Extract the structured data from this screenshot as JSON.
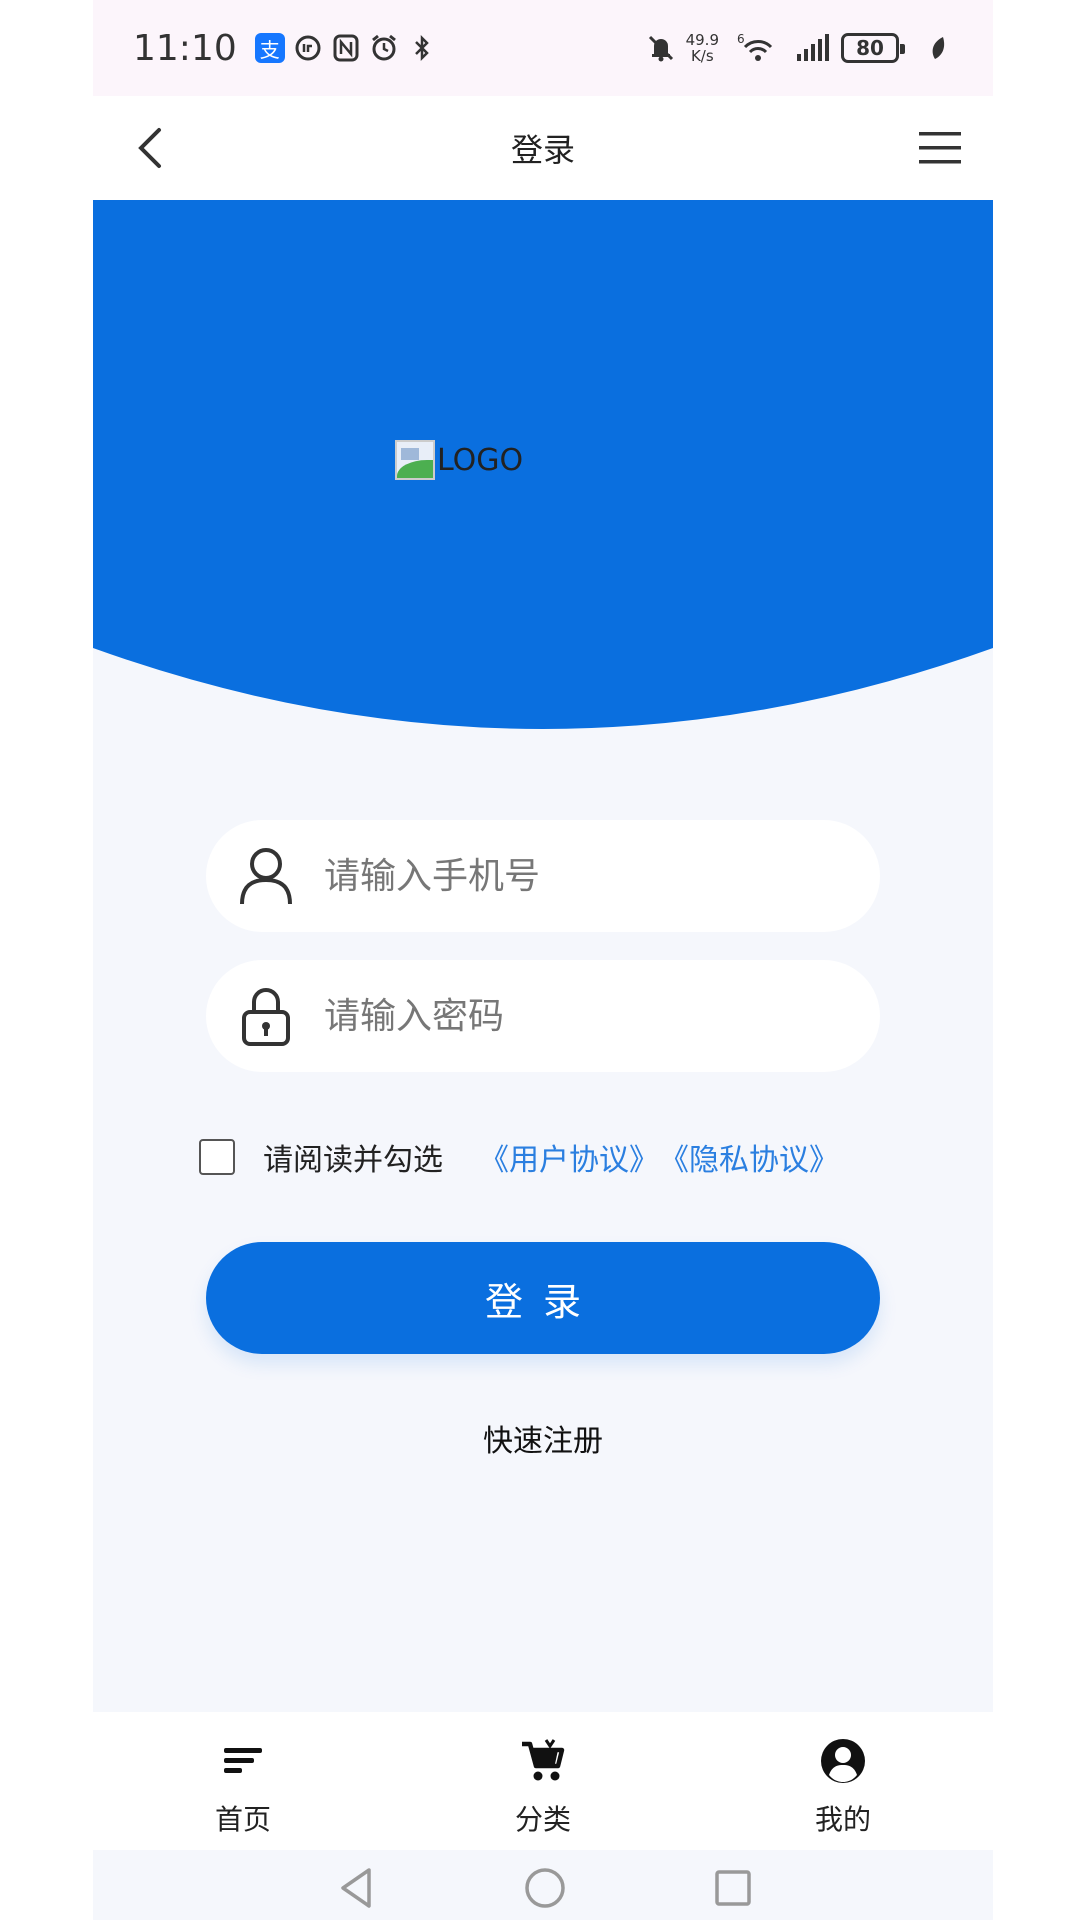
{
  "status_bar": {
    "time": "11:10",
    "net_speed_value": "49.9",
    "net_speed_unit": "K/s",
    "network_type": "6",
    "battery": "80",
    "icons": [
      "alipay-icon",
      "nfc-icon",
      "alarm-icon",
      "bluetooth-icon",
      "mute-icon",
      "wifi-icon",
      "signal-icon",
      "battery-icon",
      "leaf-icon"
    ]
  },
  "nav": {
    "title": "登录"
  },
  "hero": {
    "logo_alt": "LOGO",
    "color": "#0a6fdf"
  },
  "form": {
    "phone_placeholder": "请输入手机号",
    "password_placeholder": "请输入密码",
    "agree_text": "请阅读并勾选",
    "user_agreement": "《用户协议》",
    "privacy_agreement": "《隐私协议》",
    "login_label": "登录",
    "register_label": "快速注册"
  },
  "tabbar": {
    "items": [
      {
        "label": "首页",
        "icon": "menu-lines-icon"
      },
      {
        "label": "分类",
        "icon": "cart-icon"
      },
      {
        "label": "我的",
        "icon": "user-circle-icon"
      }
    ]
  },
  "colors": {
    "accent": "#0a6fdf",
    "link": "#2b7fe0",
    "background": "#f5f7fc"
  }
}
